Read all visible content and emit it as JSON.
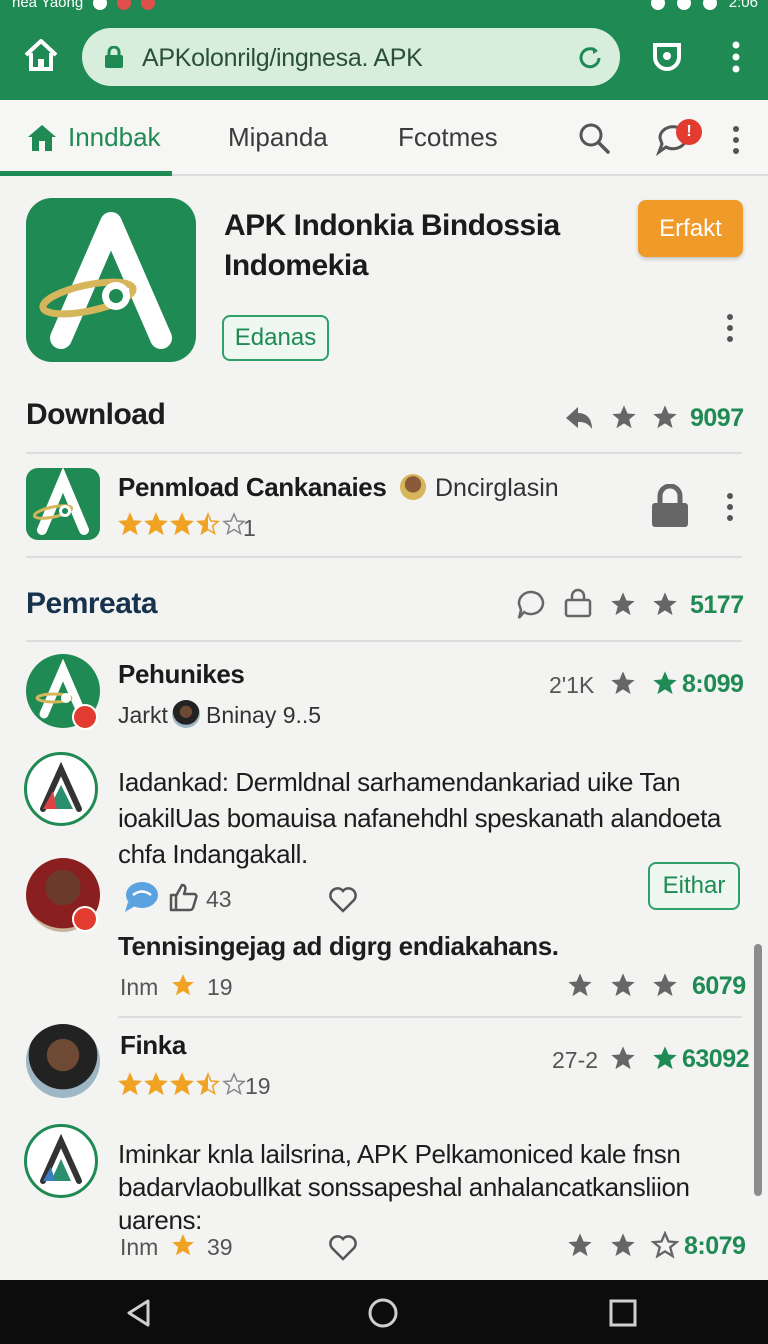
{
  "status_bar": {
    "left_text": "nea Yaong",
    "right_text": "2:06"
  },
  "browser": {
    "url": "APKolonrilg/ingnesa. APK"
  },
  "tabs": [
    {
      "label": "Inndbak",
      "active": true
    },
    {
      "label": "Mipanda",
      "active": false
    },
    {
      "label": "Fcotmes",
      "active": false
    }
  ],
  "notification_badge": "!",
  "app": {
    "title": "APK Indonkia Bindossia Indomekia",
    "install_label": "Erfakt",
    "tag_label": "Edanas"
  },
  "download_section": {
    "title": "Download",
    "count": "9097",
    "item": {
      "title": "Penmload Cankanaies",
      "publisher": "Dncirglasin",
      "rating": 3.5,
      "rating_count": "1"
    }
  },
  "reviews_section": {
    "title": "Pemreata",
    "count": "5177",
    "reviews": [
      {
        "author": "Pehunikes",
        "sub_left": "Jarkt",
        "sub_right": "Bninay 9..5",
        "count": "2'1K",
        "score": "8:099"
      },
      {
        "text": "Iadankad: Dermldnal sarhamendankariad uike Tan ioakilUas bomauisa nafanehdhl speskanath alandoeta chfa Indangakall.",
        "comments": "43",
        "button": "Eithar"
      },
      {
        "text": "Tennisingejag ad digrg endiakahans.",
        "meta_left": "Inm",
        "meta_num": "19",
        "score": "6079"
      },
      {
        "author": "Finka",
        "rating": 3.5,
        "rating_count": "19",
        "count": "27-2",
        "score": "63092"
      },
      {
        "text": "Iminkar knla lailsrina, APK Pelkamoniced kale fnsn badarvlaobullkat sonssapeshal anhalancatkansliion uarens:",
        "meta_left": "Inm",
        "meta_num": "39",
        "score": "8:079"
      }
    ]
  },
  "colors": {
    "brand_green": "#1f8a53",
    "accent_orange": "#f09a2a",
    "star_gold": "#f0a323",
    "badge_red": "#e23b2f"
  }
}
